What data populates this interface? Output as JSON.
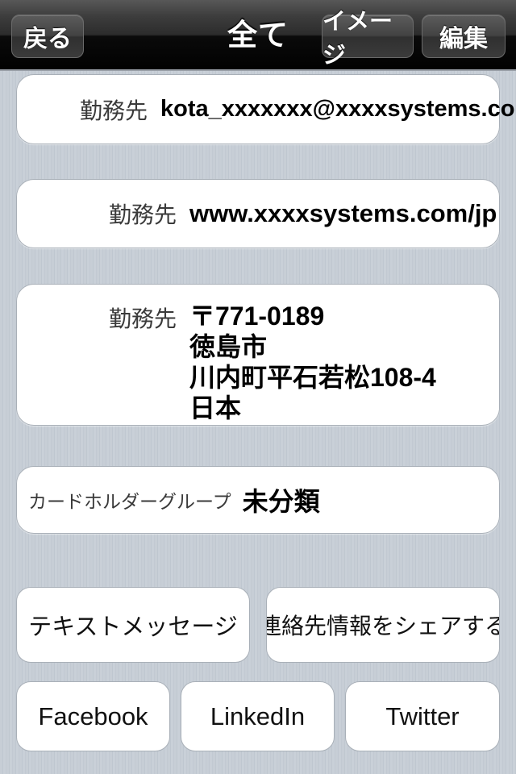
{
  "navbar": {
    "title": "全て",
    "back_label": "戻る",
    "image_label": "イメージ",
    "edit_label": "編集"
  },
  "fields": [
    {
      "label": "勤務先",
      "value": "kota_xxxxxxx@xxxxsystems.com"
    },
    {
      "label": "勤務先",
      "value": "www.xxxxsystems.com/jp"
    },
    {
      "label": "勤務先",
      "lines": [
        "〒771-0189",
        "徳島市",
        "川内町平石若松108-4",
        "日本"
      ]
    },
    {
      "label": "カードホルダーグループ",
      "value": "未分類"
    }
  ],
  "actions": {
    "sms_label": "テキストメッセージ",
    "share_label": "連絡先情報をシェアする",
    "facebook_label": "Facebook",
    "linkedin_label": "LinkedIn",
    "twitter_label": "Twitter"
  },
  "colors": {
    "background": "#c5ccd4",
    "card": "#ffffff",
    "card_border": "#a9b0b8",
    "navbar_dark": "#020202",
    "navbar_light": "#585858",
    "text": "#000000",
    "label_text": "#3a3a3a",
    "nav_text": "#ffffff"
  }
}
